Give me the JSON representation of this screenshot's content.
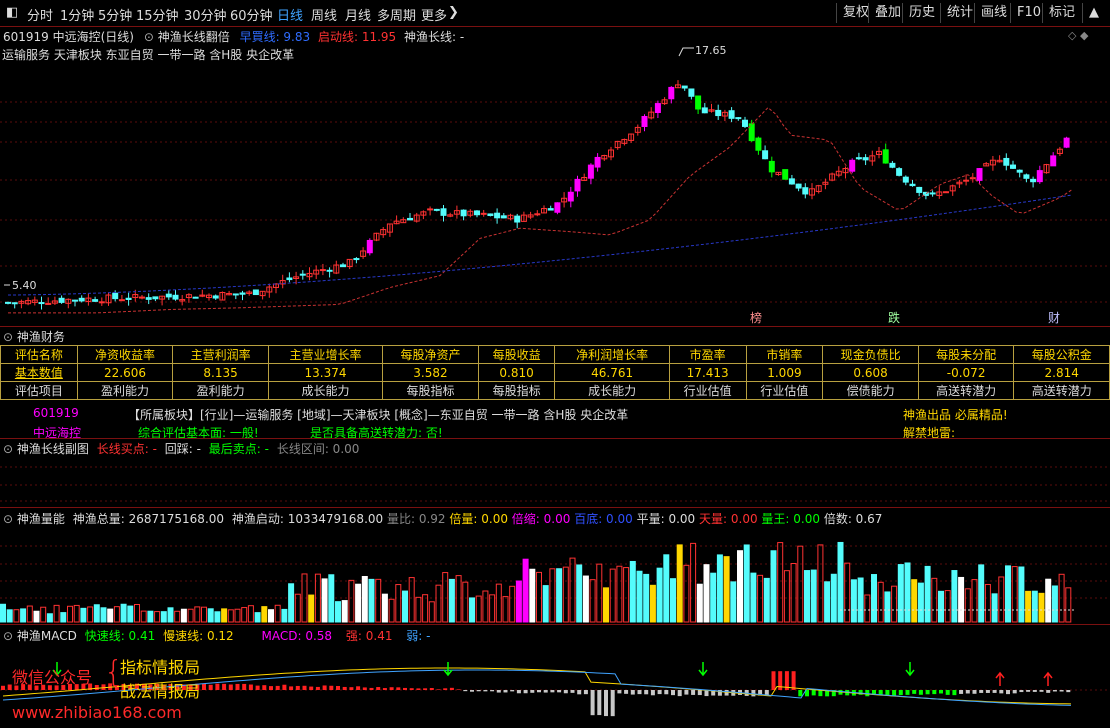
{
  "toolbar": {
    "periods": [
      "分时",
      "1分钟",
      "5分钟",
      "15分钟",
      "30分钟",
      "60分钟",
      "日线",
      "周线",
      "月线",
      "多周期",
      "更多"
    ],
    "active": "日线",
    "right": [
      "复权",
      "叠加",
      "历史",
      "统计",
      "画线",
      "F10",
      "标记"
    ]
  },
  "main": {
    "code_name": "601919 中远海控(日线)",
    "indicator": "神渔长线翻倍",
    "early": "早買线: 9.83",
    "launch": "启动线: 11.95",
    "long_line": "神渔长线: -",
    "concepts": "运输服务  天津板块  东亚自贸 一带一路 含H股 央企改革",
    "high_label": "17.65",
    "low_label": "5.40",
    "markers": [
      "榜",
      "跌",
      "财"
    ]
  },
  "finance": {
    "title": "神渔财务",
    "headers": [
      "评估名称",
      "净资收益率",
      "主营利润率",
      "主营业增长率",
      "每股净资产",
      "每股收益",
      "净利润增长率",
      "市盈率",
      "市销率",
      "现金负债比",
      "每股未分配",
      "每股公积金"
    ],
    "values": [
      "基本数值",
      "22.606",
      "8.135",
      "13.374",
      "3.582",
      "0.810",
      "46.761",
      "17.413",
      "1.009",
      "0.608",
      "-0.072",
      "2.814"
    ],
    "labels": [
      "评估项目",
      "盈利能力",
      "盈利能力",
      "成长能力",
      "每股指标",
      "每股指标",
      "成长能力",
      "行业估值",
      "行业估值",
      "偿债能力",
      "高送转潜力",
      "高送转潜力"
    ],
    "code": "601919",
    "name": "中远海控",
    "info_line": "【所属板块】[行业]—运输服务 [地域]—天津板块 [概念]—东亚自贸 一带一路 含H股 央企改革",
    "assess": "综合评估基本面: 一般!",
    "transfer": "是否具备高送转潜力: 否!",
    "brand": "神渔出品 必属精品!",
    "mine": "解禁地雷:"
  },
  "sub1": {
    "title": "神渔长线副图",
    "buy": "长线买点: -",
    "pullback": "回踩: -",
    "sell": "最后卖点: -",
    "range": "长线区间: 0.00"
  },
  "vol": {
    "title": "神渔量能",
    "total": "神渔总量: 2687175168.00",
    "launch": "神渔启动: 1033479168.00",
    "ratio": "量比: 0.92",
    "bei": "倍量: 0.00",
    "beifu": "倍缩: 0.00",
    "baidi": "百底: 0.00",
    "ping": "平量: 0.00",
    "tian": "天量: 0.00",
    "king": "量王: 0.00",
    "times": "倍数: 0.67"
  },
  "macd": {
    "title": "神渔MACD",
    "fast": "快速线: 0.41",
    "slow": "慢速线: 0.12",
    "macd": "MACD: 0.58",
    "strong": "强: 0.41",
    "weak": "弱: -"
  },
  "watermark": {
    "wechat": "微信公众号",
    "line1": "指标情报局",
    "line2": "战法情报局",
    "url": "www.zhibiao168.com"
  },
  "colors": {
    "up": "#ff3232",
    "down": "#54fcfc",
    "magenta": "#ff00ff",
    "green": "#00ff00",
    "ma_red": "#c83232",
    "ma_blue": "#2838c8"
  }
}
